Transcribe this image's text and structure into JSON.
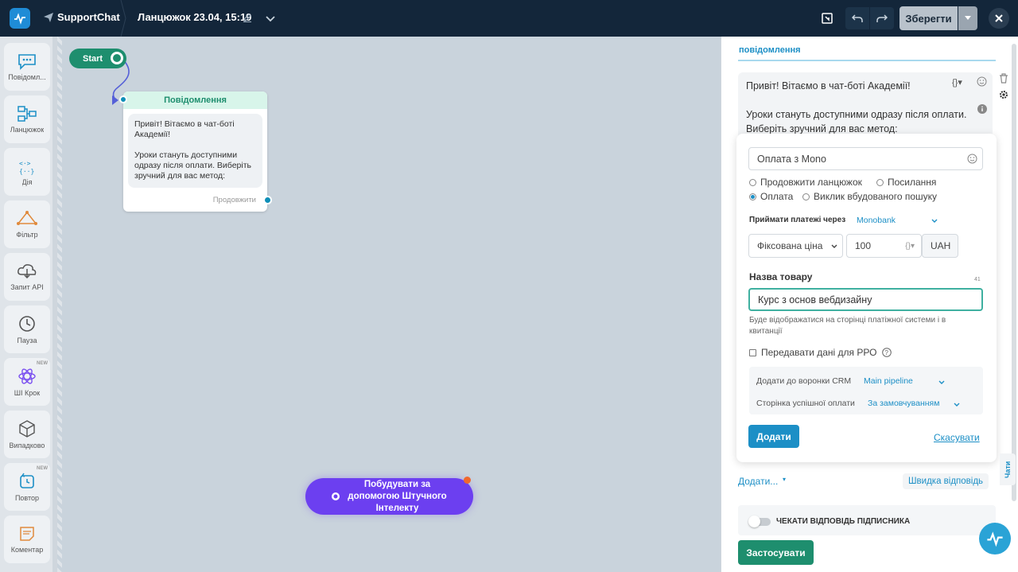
{
  "topbar": {
    "brand": "SupportChat",
    "chain_title": "Ланцюжок 23.04, 15:19",
    "save_label": "Зберегти"
  },
  "sidebar": {
    "items": [
      {
        "label": "Повідомл...",
        "icon": "chat-bubble-icon",
        "color": "#1c8fc6"
      },
      {
        "label": "Ланцюжок",
        "icon": "flow-chain-icon",
        "color": "#1c8fc6"
      },
      {
        "label": "Дія",
        "icon": "action-braces-icon",
        "color": "#1c8fc6"
      },
      {
        "label": "Фільтр",
        "icon": "filter-branch-icon",
        "color": "#e08a3c"
      },
      {
        "label": "Запит API",
        "icon": "cloud-api-icon",
        "color": "#555"
      },
      {
        "label": "Пауза",
        "icon": "clock-icon",
        "color": "#555"
      },
      {
        "label": "ШІ Крок",
        "icon": "ai-atom-icon",
        "color": "#7a4ff0",
        "badge": "NEW"
      },
      {
        "label": "Випадково",
        "icon": "dice-cube-icon",
        "color": "#555"
      },
      {
        "label": "Повтор",
        "icon": "repeat-icon",
        "color": "#1c8fc6",
        "badge": "NEW"
      },
      {
        "label": "Коментар",
        "icon": "note-icon",
        "color": "#e08a3c"
      }
    ]
  },
  "canvas": {
    "start_label": "Start",
    "node_title": "Повідомлення",
    "node_text": "Привіт! Вітаємо в чат-боті Академії!\n\nУроки стануть доступними одразу після оплати. Виберіть зручний для вас метод:",
    "node_continue": "Продовжити",
    "ai_button": "Побудувати за допомогою Штучного Інтелекту"
  },
  "panel": {
    "title": "повідомлення",
    "message_text": "Привіт! Вітаємо в чат-боті Академії!\n\nУроки стануть доступними одразу після оплати. Виберіть зручний для вас метод:",
    "button_text": "Оплата з Mono",
    "options": {
      "continue_chain": "Продовжити ланцюжок",
      "link": "Посилання",
      "payment": "Оплата",
      "builtin_search": "Виклик вбудованого пошуку",
      "selected": "Оплата"
    },
    "accept_payments_label": "Приймати платежі через",
    "provider": "Monobank",
    "price_type": "Фіксована ціна",
    "price_value": "100",
    "currency": "UAH",
    "product_name_label": "Назва товару",
    "product_name_counter": "41",
    "product_name_value": "Курс з основ вебдизайну",
    "product_hint": "Буде відображатися на сторінці платіжної системи і в квитанції",
    "rro_label": "Передавати дані для РРО",
    "crm_label": "Додати до воронки CRM",
    "crm_value": "Main pipeline",
    "success_page_label": "Сторінка успішної оплати",
    "success_page_value": "За замовчуванням",
    "add_button": "Додати",
    "cancel_link": "Скасувати",
    "add_more": "Додати...",
    "quick_reply": "Швидка відповідь",
    "wait_reply_label": "ЧЕКАТИ ВІДПОВІДЬ ПІДПИСНИКА",
    "apply_button": "Застосувати",
    "chats_tab": "Чати"
  },
  "colors": {
    "accent": "#1c8fc6",
    "green": "#1e8e6e",
    "purple": "#6c3ff0",
    "topbar": "#13263a"
  }
}
